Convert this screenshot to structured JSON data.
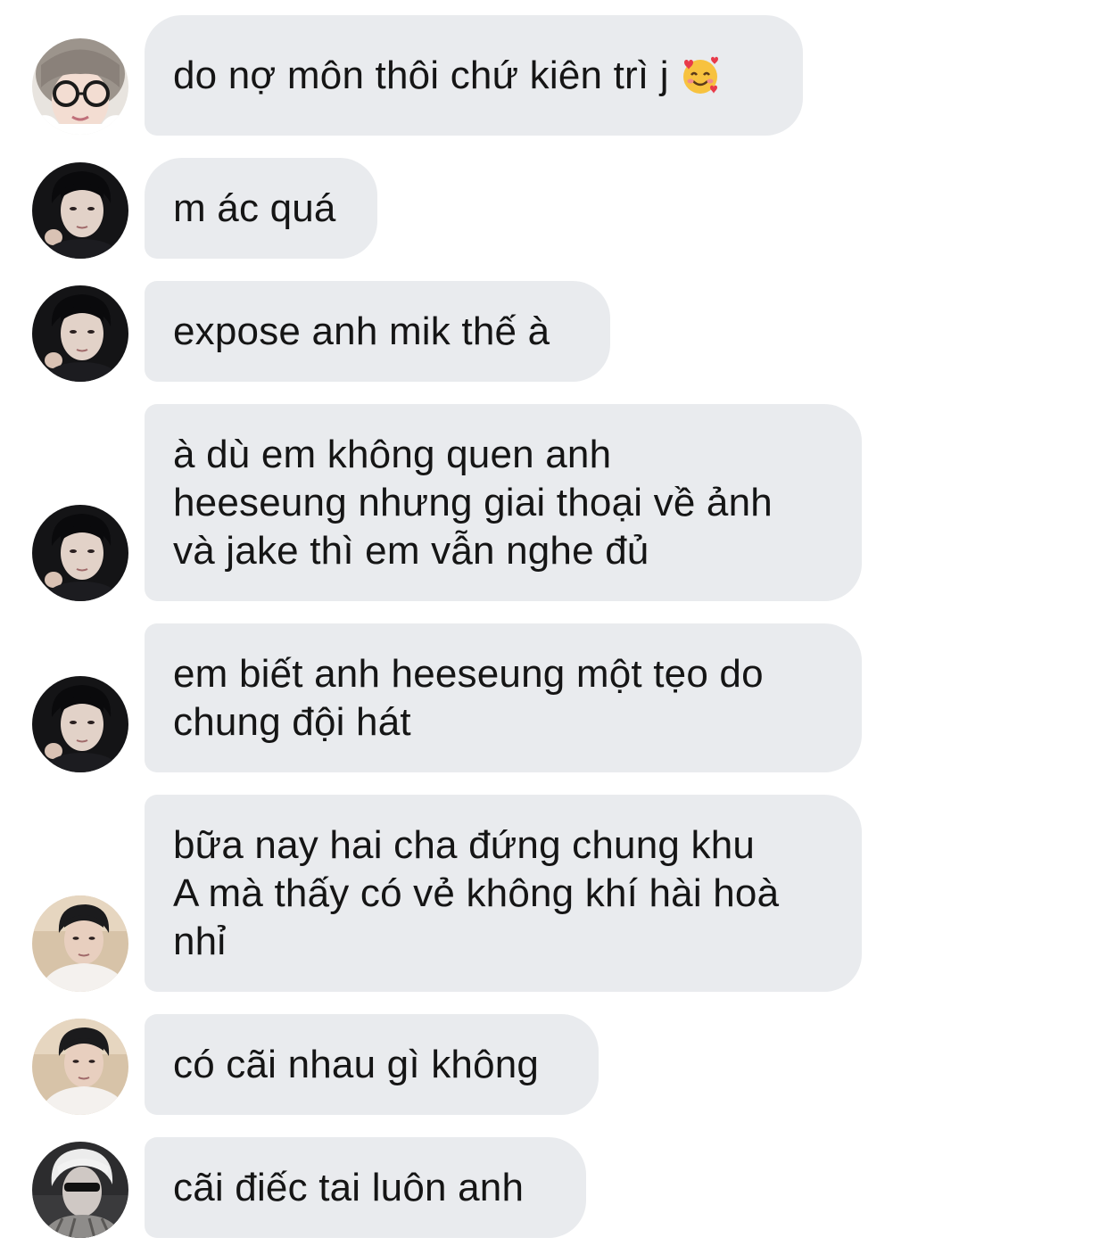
{
  "messages": [
    {
      "text": "do nợ môn thôi chứ kiên trì j",
      "emoji": "smiling-face-with-hearts-icon",
      "avatar": "avatar-glasses-girl"
    },
    {
      "text": "m ác quá",
      "avatar": "avatar-dark-jacket-boy"
    },
    {
      "text": "expose anh mik thế à",
      "avatar": "avatar-dark-jacket-boy"
    },
    {
      "text": "à dù em không quen anh\nheeseung nhưng giai thoại về ảnh\nvà jake thì em vẫn nghe đủ",
      "avatar": "avatar-dark-jacket-boy"
    },
    {
      "text": "em biết anh heeseung một tẹo do\nchung đội hát",
      "avatar": "avatar-dark-jacket-boy"
    },
    {
      "text": "bữa nay hai cha đứng chung khu\nA mà thấy có vẻ không khí hài hoà\nnhỉ",
      "avatar": "avatar-beach-boy"
    },
    {
      "text": "có cãi nhau gì không",
      "avatar": "avatar-beach-boy"
    },
    {
      "text": "cãi điếc tai luôn anh",
      "avatar": "avatar-blonde-sunglasses"
    }
  ],
  "colors": {
    "bubble": "#e9ebee",
    "text": "#151515",
    "background": "#ffffff"
  }
}
